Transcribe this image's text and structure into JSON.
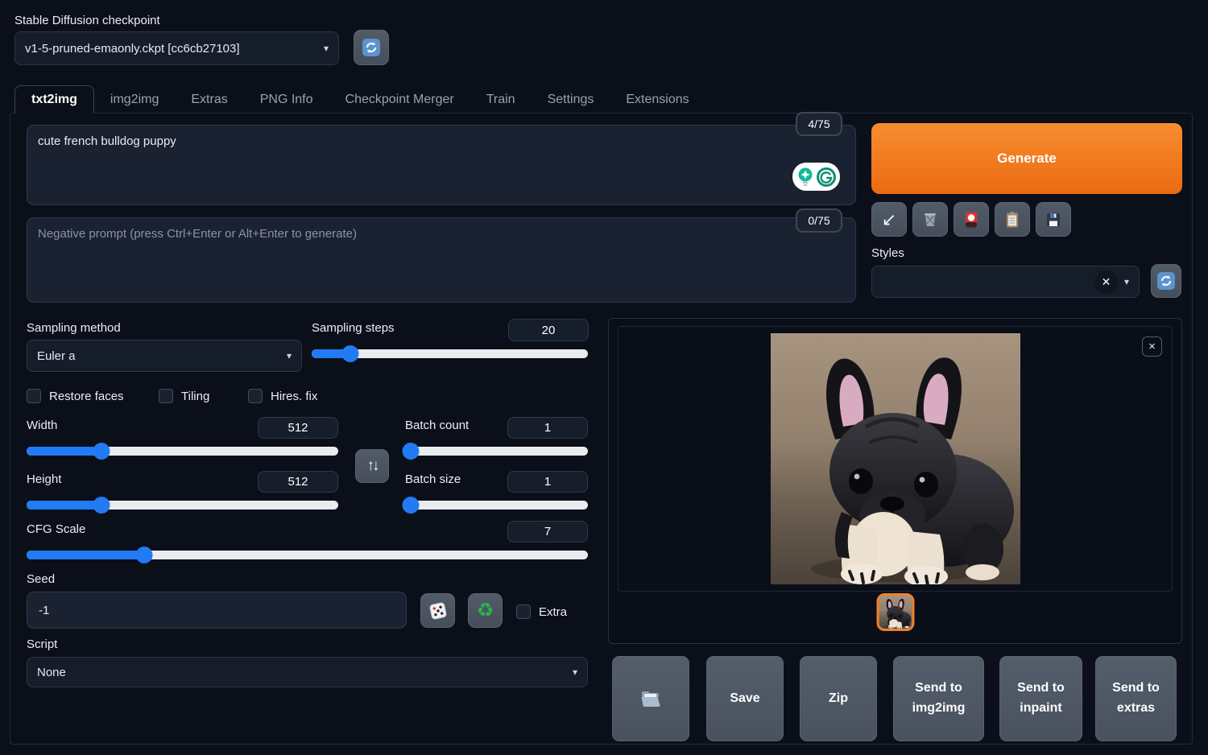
{
  "header": {
    "checkpoint_label": "Stable Diffusion checkpoint",
    "checkpoint_value": "v1-5-pruned-emaonly.ckpt [cc6cb27103]"
  },
  "tabs": [
    {
      "label": "txt2img",
      "active": true
    },
    {
      "label": "img2img",
      "active": false
    },
    {
      "label": "Extras",
      "active": false
    },
    {
      "label": "PNG Info",
      "active": false
    },
    {
      "label": "Checkpoint Merger",
      "active": false
    },
    {
      "label": "Train",
      "active": false
    },
    {
      "label": "Settings",
      "active": false
    },
    {
      "label": "Extensions",
      "active": false
    }
  ],
  "prompt": {
    "value": "cute french bulldog puppy",
    "counter": "4/75"
  },
  "negative_prompt": {
    "placeholder": "Negative prompt (press Ctrl+Enter or Alt+Enter to generate)",
    "counter": "0/75"
  },
  "generate_label": "Generate",
  "styles": {
    "label": "Styles",
    "value": ""
  },
  "sampling": {
    "method_label": "Sampling method",
    "method_value": "Euler a",
    "steps_label": "Sampling steps",
    "steps_value": "20",
    "steps_percent": "14%"
  },
  "options": [
    {
      "label": "Restore faces",
      "checked": false
    },
    {
      "label": "Tiling",
      "checked": false
    },
    {
      "label": "Hires. fix",
      "checked": false
    }
  ],
  "dimensions": {
    "width_label": "Width",
    "width_value": "512",
    "width_percent": "24%",
    "height_label": "Height",
    "height_value": "512",
    "height_percent": "24%"
  },
  "batch": {
    "count_label": "Batch count",
    "count_value": "1",
    "count_percent": "3%",
    "size_label": "Batch size",
    "size_value": "1",
    "size_percent": "3%"
  },
  "cfg": {
    "label": "CFG Scale",
    "value": "7",
    "percent": "21%"
  },
  "seed": {
    "label": "Seed",
    "value": "-1",
    "extra_label": "Extra"
  },
  "script": {
    "label": "Script",
    "value": "None"
  },
  "output": {
    "buttons": [
      "Save",
      "Zip",
      "Send to img2img",
      "Send to inpaint",
      "Send to extras"
    ],
    "image_description": "generated photo of a cute black french bulldog puppy on a brown background"
  },
  "icons": {
    "refresh-icon": "🔄",
    "paste-params-icon": "↙",
    "trash-icon": "🗑",
    "extra-networks-icon": "🎴",
    "apply-style-icon": "📋",
    "save-style-icon": "💾",
    "swap-dimensions-icon": "↑↓",
    "dice-icon": "🎲",
    "recycle-seed-icon": "♻",
    "folder-icon": "📂",
    "close-icon": "×",
    "clear-icon": "✕",
    "caret-icon": "▾",
    "grammarly-icon": "G"
  },
  "colors": {
    "accent_orange": "#ee6c12",
    "slider_blue": "#217bf4",
    "selected_thumb_border": "#f0802a",
    "page_background": "#0b0f19"
  }
}
